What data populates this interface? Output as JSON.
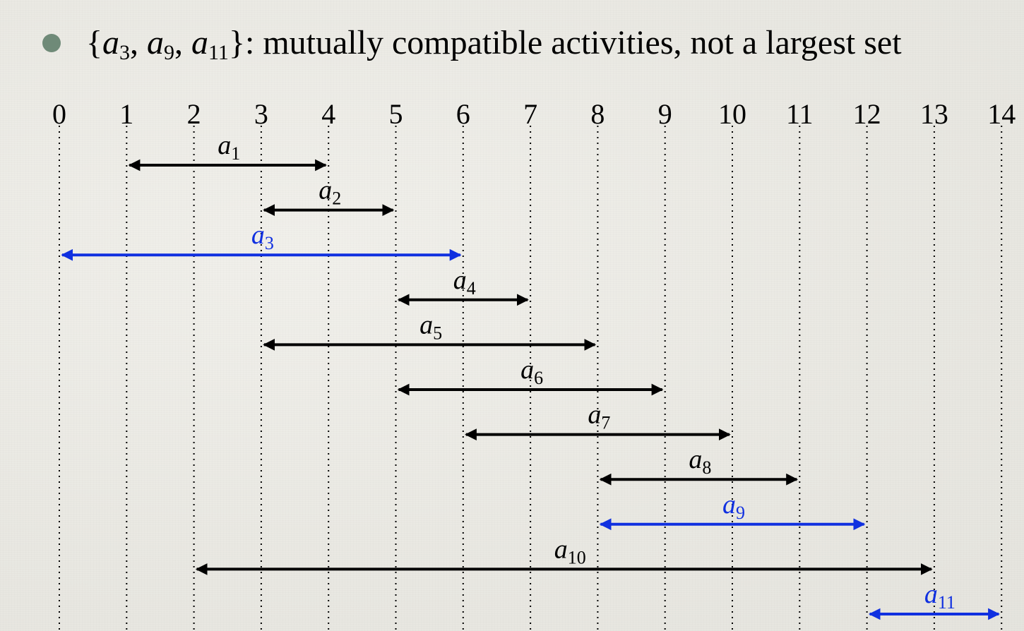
{
  "bullet": {
    "prefix": "{",
    "items": [
      {
        "base": "a",
        "sub": "3"
      },
      {
        "base": "a",
        "sub": "9"
      },
      {
        "base": "a",
        "sub": "11"
      }
    ],
    "suffix": "}: mutually compatible activities, not a largest set"
  },
  "colors": {
    "default": "#000000",
    "highlight": "#1030e0",
    "bullet": "#6f8a78"
  },
  "axis": {
    "ticks": [
      "0",
      "1",
      "2",
      "3",
      "4",
      "5",
      "6",
      "7",
      "8",
      "9",
      "10",
      "11",
      "12",
      "13",
      "14"
    ],
    "range": [
      0,
      14
    ]
  },
  "chart_data": {
    "type": "interval",
    "activities": [
      {
        "name": "1",
        "start": 1,
        "finish": 4,
        "selected": false
      },
      {
        "name": "2",
        "start": 3,
        "finish": 5,
        "selected": false
      },
      {
        "name": "3",
        "start": 0,
        "finish": 6,
        "selected": true
      },
      {
        "name": "4",
        "start": 5,
        "finish": 7,
        "selected": false
      },
      {
        "name": "5",
        "start": 3,
        "finish": 8,
        "selected": false
      },
      {
        "name": "6",
        "start": 5,
        "finish": 9,
        "selected": false
      },
      {
        "name": "7",
        "start": 6,
        "finish": 10,
        "selected": false
      },
      {
        "name": "8",
        "start": 8,
        "finish": 11,
        "selected": false
      },
      {
        "name": "9",
        "start": 8,
        "finish": 12,
        "selected": true
      },
      {
        "name": "10",
        "start": 2,
        "finish": 13,
        "selected": false
      },
      {
        "name": "11",
        "start": 12,
        "finish": 14,
        "selected": true
      }
    ]
  }
}
